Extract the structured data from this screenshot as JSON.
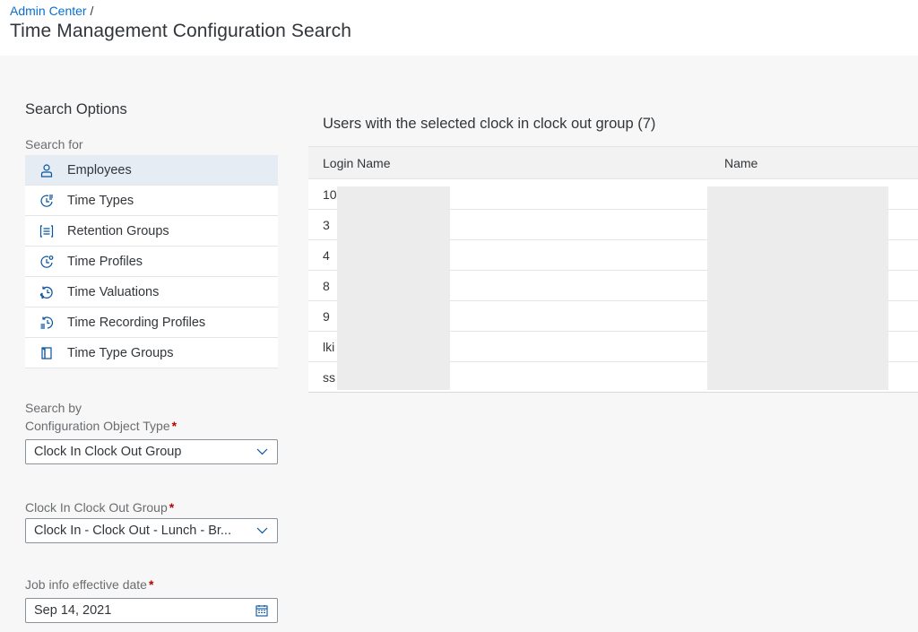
{
  "breadcrumb": {
    "link": "Admin Center",
    "separator": "/"
  },
  "page_title": "Time Management Configuration Search",
  "search_options": {
    "title": "Search Options",
    "search_for_label": "Search for",
    "items": [
      {
        "label": "Employees",
        "icon": "person-icon",
        "selected": true
      },
      {
        "label": "Time Types",
        "icon": "time-type-icon",
        "selected": false
      },
      {
        "label": "Retention Groups",
        "icon": "retention-groups-icon",
        "selected": false
      },
      {
        "label": "Time Profiles",
        "icon": "time-profile-icon",
        "selected": false
      },
      {
        "label": "Time Valuations",
        "icon": "time-valuation-icon",
        "selected": false
      },
      {
        "label": "Time Recording Profiles",
        "icon": "time-recording-icon",
        "selected": false
      },
      {
        "label": "Time Type Groups",
        "icon": "time-type-group-icon",
        "selected": false
      }
    ],
    "search_by_label": "Search by",
    "config_object_type_label": "Configuration Object Type",
    "config_object_type_value": "Clock In Clock Out Group",
    "clock_group_label": "Clock In Clock Out Group",
    "clock_group_value": "Clock In - Clock Out - Lunch - Br...",
    "date_label": "Job info effective date",
    "date_value": "Sep 14, 2021",
    "required_marker": "*"
  },
  "results": {
    "title": "Users with the selected clock in clock out group (7)",
    "columns": [
      "Login Name",
      "Name"
    ],
    "rows": [
      {
        "login": "10"
      },
      {
        "login": "3"
      },
      {
        "login": "4"
      },
      {
        "login": "8"
      },
      {
        "login": "9"
      },
      {
        "login": "lki"
      },
      {
        "login": "ss"
      }
    ]
  },
  "colors": {
    "link": "#0a6ed1",
    "required": "#bb0000",
    "selected_row": "#e5ecf3",
    "icon": "#0854a0"
  }
}
